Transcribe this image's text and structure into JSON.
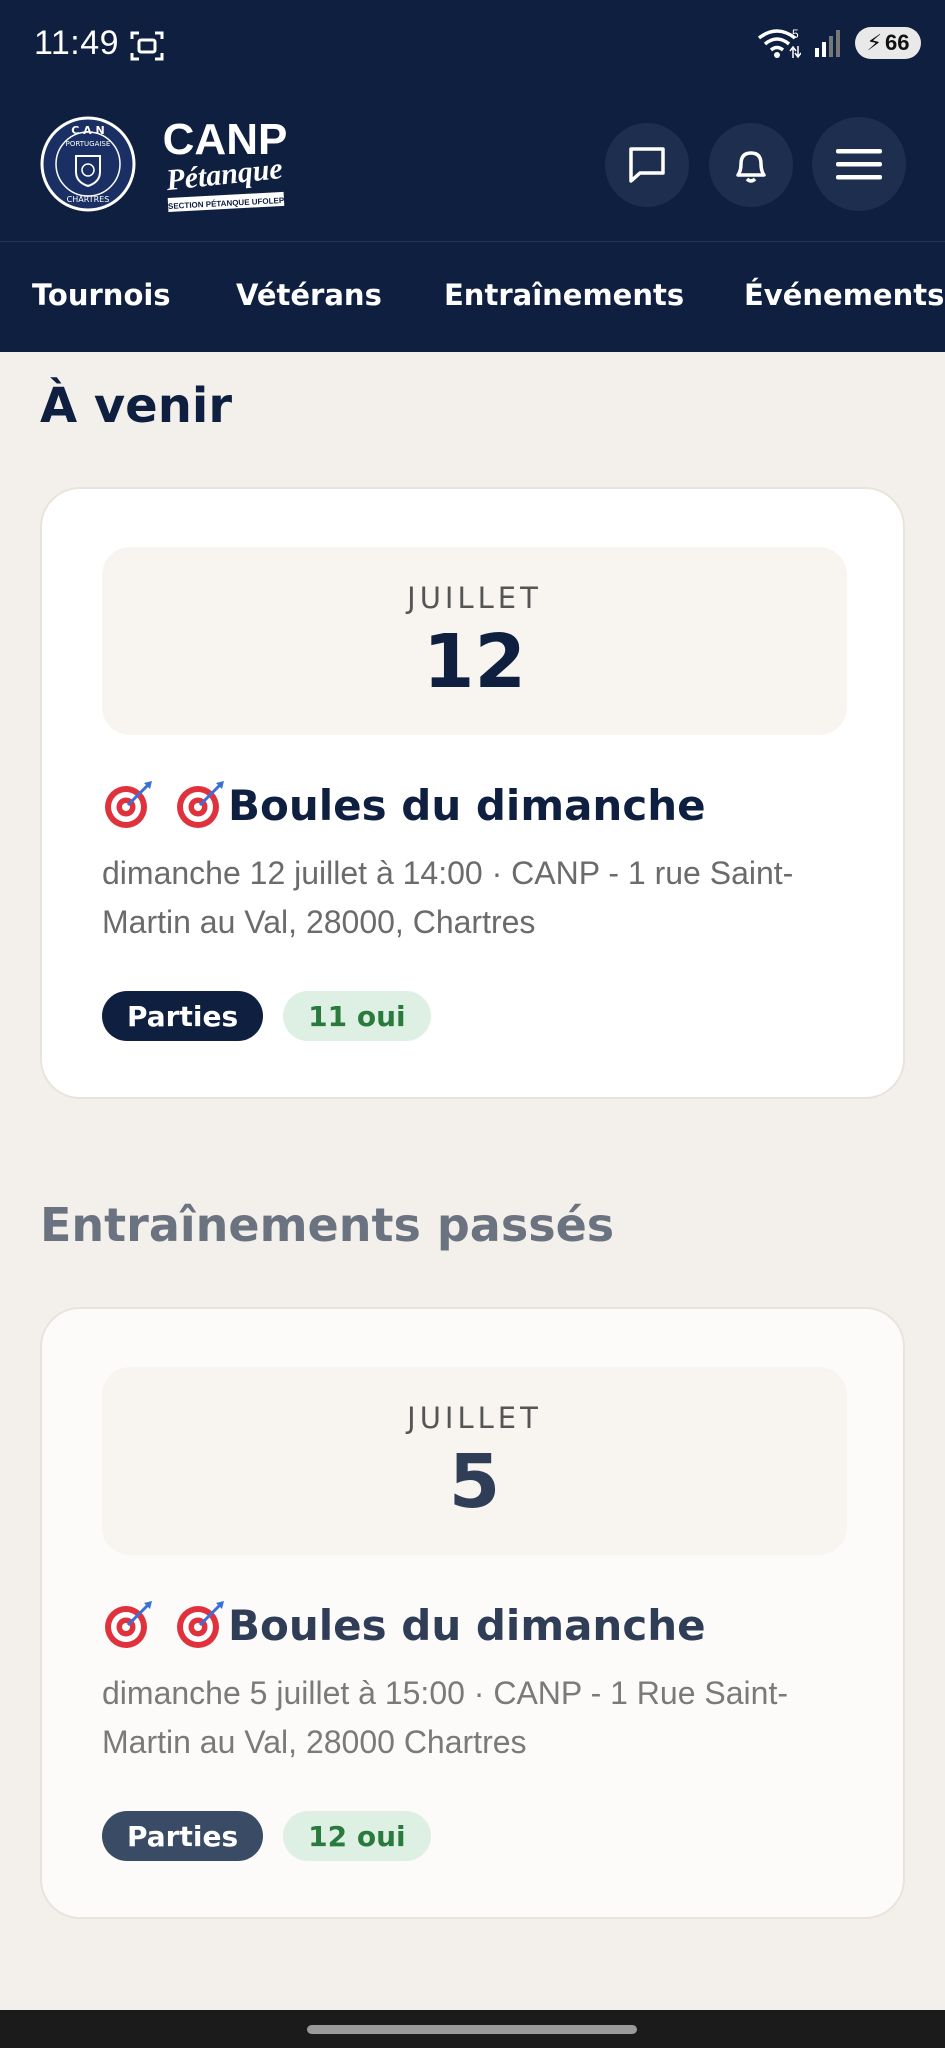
{
  "status_bar": {
    "time": "11:49",
    "wifi_superscript": "5",
    "battery": "66"
  },
  "header": {
    "club_logo_text_top": "C A N",
    "club_logo_text_mid": "PORTUGAISE",
    "club_logo_text_bottom": "CHARTRES",
    "brand_line1": "CANP",
    "brand_line2": "Pétanque",
    "brand_line3": "SECTION PÉTANQUE UFOLEP"
  },
  "tabs": [
    "Tournois",
    "Vétérans",
    "Entraînements",
    "Événements"
  ],
  "upcoming": {
    "title": "À venir",
    "event": {
      "month": "JUILLET",
      "day": "12",
      "title": "Boules du dimanche",
      "detail": "dimanche 12 juillet à 14:00 · CANP - 1 rue Saint-Martin au Val, 28000, Chartres",
      "badge_type": "Parties",
      "badge_count": "11 oui"
    }
  },
  "past": {
    "title": "Entraînements passés",
    "event": {
      "month": "JUILLET",
      "day": "5",
      "title": "Boules du dimanche",
      "detail": "dimanche 5 juillet à 15:00 · CANP - 1 Rue Saint-Martin au Val, 28000 Chartres",
      "badge_type": "Parties",
      "badge_count": "12 oui"
    }
  },
  "colors": {
    "navy": "#0e1f40",
    "background": "#f3f0eb",
    "success_bg": "#def0e3",
    "success_text": "#2a7a3e"
  },
  "icons": [
    "screenshot-icon",
    "wifi-icon",
    "signal-icon",
    "battery-icon",
    "chat-icon",
    "bell-icon",
    "menu-icon",
    "target-icon"
  ]
}
